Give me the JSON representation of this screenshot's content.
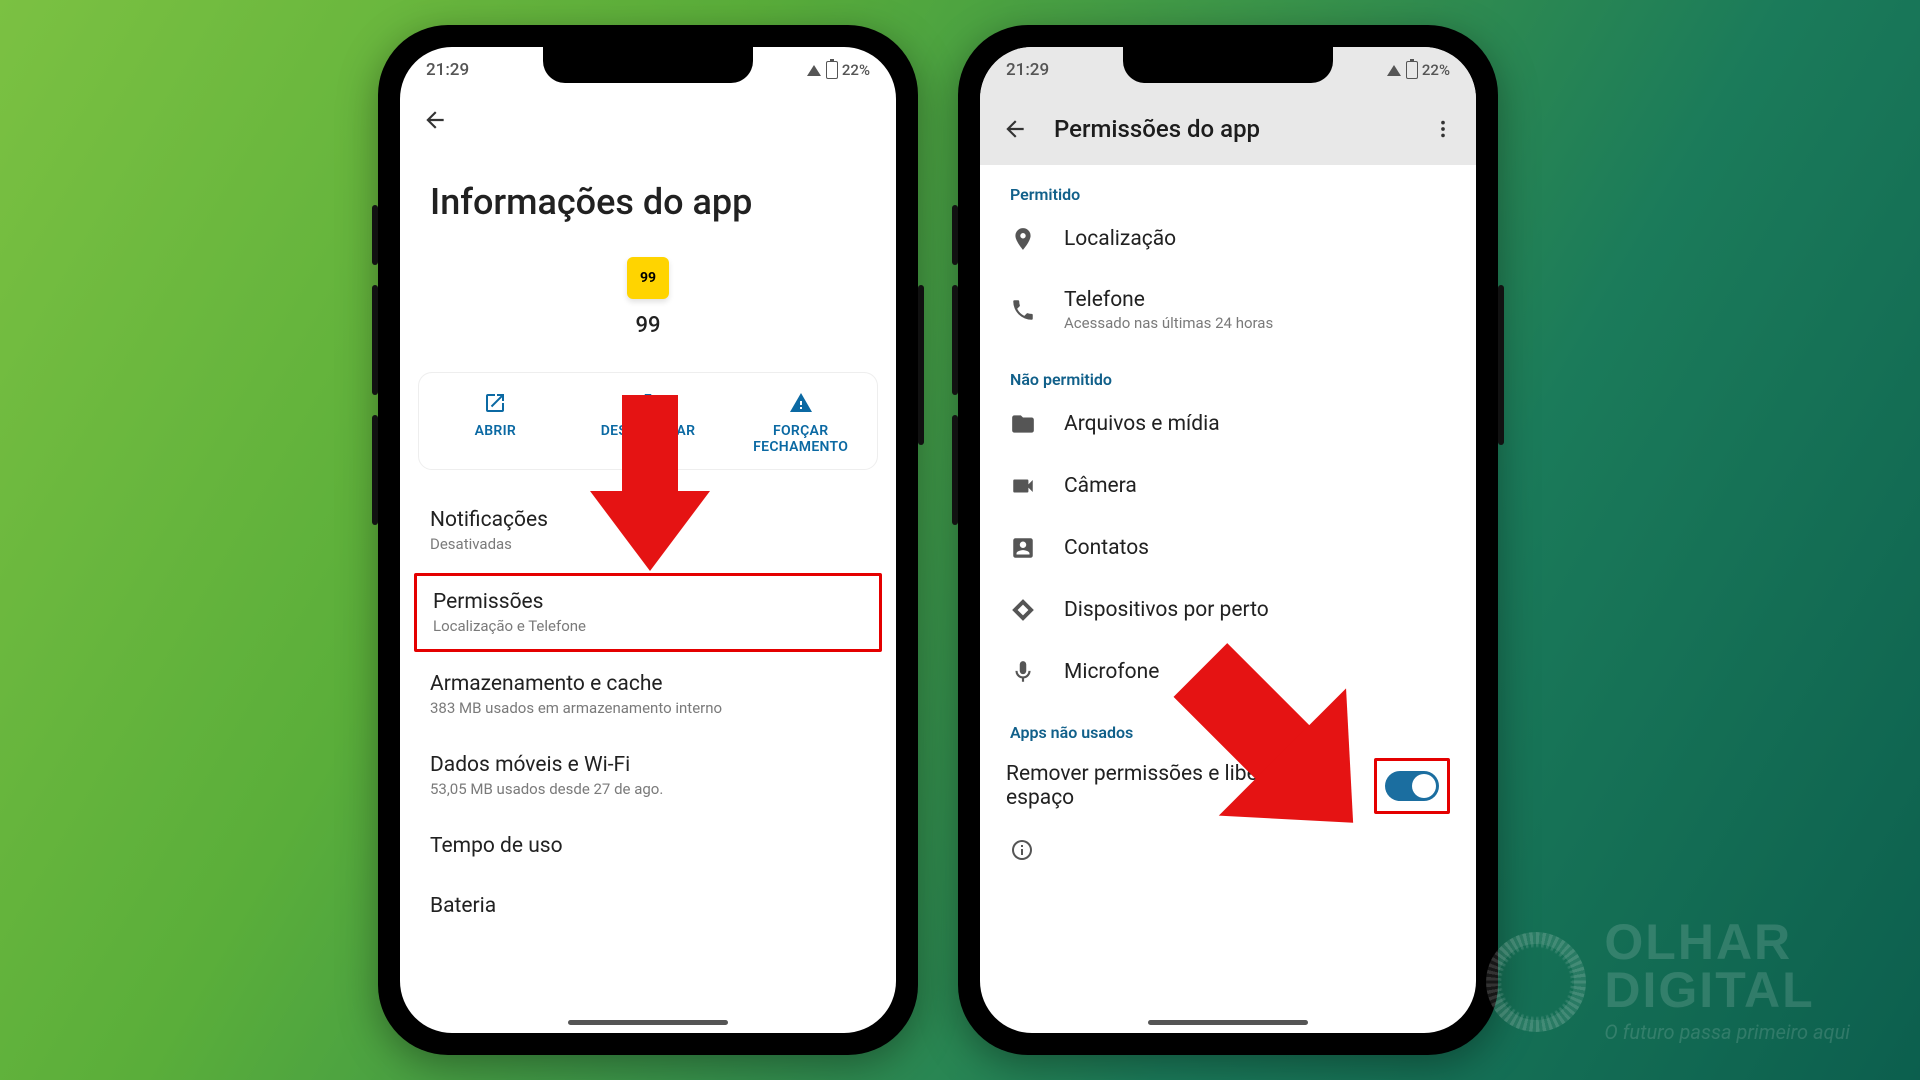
{
  "status": {
    "time": "21:29",
    "battery": "22%"
  },
  "phone_left": {
    "title": "Informações do app",
    "app": {
      "icon_text": "99",
      "name": "99"
    },
    "actions": {
      "open": "ABRIR",
      "uninstall": "DESINSTALAR",
      "force_stop_l1": "FORÇAR",
      "force_stop_l2": "FECHAMENTO"
    },
    "settings": {
      "notifications": {
        "label": "Notificações",
        "sub": "Desativadas"
      },
      "permissions": {
        "label": "Permissões",
        "sub": "Localização e Telefone"
      },
      "storage": {
        "label": "Armazenamento e cache",
        "sub": "383 MB usados em armazenamento interno"
      },
      "data": {
        "label": "Dados móveis e Wi-Fi",
        "sub": "53,05 MB usados desde 27 de ago."
      },
      "screen_time": {
        "label": "Tempo de uso"
      },
      "battery": {
        "label": "Bateria"
      }
    }
  },
  "phone_right": {
    "appbar_title": "Permissões do app",
    "section_allowed": "Permitido",
    "allowed": {
      "location": {
        "label": "Localização"
      },
      "phone": {
        "label": "Telefone",
        "sub": "Acessado nas últimas 24 horas"
      }
    },
    "section_denied": "Não permitido",
    "denied": {
      "files": "Arquivos e mídia",
      "camera": "Câmera",
      "contacts": "Contatos",
      "nearby": "Dispositivos por perto",
      "mic": "Microfone"
    },
    "section_unused": "Apps não usados",
    "remove_label": "Remover permissões e liberar espaço"
  },
  "watermark": {
    "brand_l1": "OLHAR",
    "brand_l2": "DIGITAL",
    "tagline": "O futuro passa primeiro aqui"
  }
}
